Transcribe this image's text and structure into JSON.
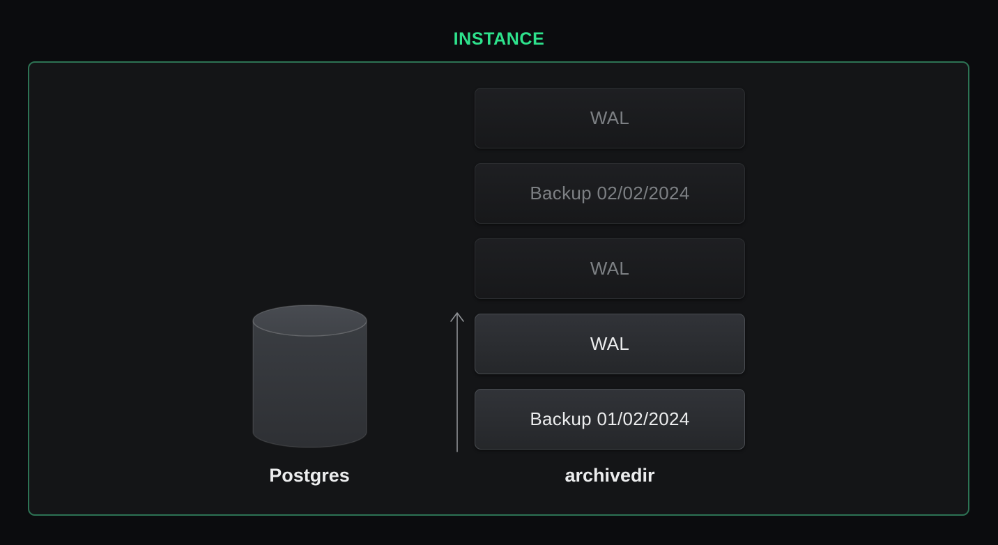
{
  "title": "INSTANCE",
  "colors": {
    "accent_green": "#2ee28c",
    "border_green": "#2d7354",
    "bright_text": "#ecedee",
    "dimmed_text": "#7d8084",
    "bright_box_bg": "#2b2d31",
    "dimmed_box_bg": "#1a1b1e",
    "page_bg": "#0b0c0e",
    "instance_bg": "#141517"
  },
  "instance": {
    "postgres": {
      "label": "Postgres",
      "icon": "database-cylinder-icon"
    },
    "arrow": {
      "icon": "arrow-up-icon",
      "direction": "up"
    },
    "archivedir": {
      "label": "archivedir",
      "items": [
        {
          "label": "WAL",
          "type": "wal",
          "state": "dimmed"
        },
        {
          "label": "Backup 02/02/2024",
          "type": "backup",
          "state": "dimmed"
        },
        {
          "label": "WAL",
          "type": "wal",
          "state": "dimmed"
        },
        {
          "label": "WAL",
          "type": "wal",
          "state": "bright"
        },
        {
          "label": "Backup 01/02/2024",
          "type": "backup",
          "state": "bright"
        }
      ]
    }
  }
}
